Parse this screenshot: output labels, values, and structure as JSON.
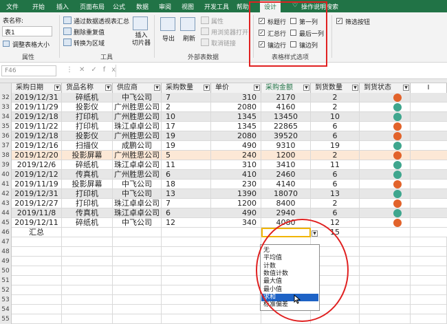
{
  "tabs": [
    "文件",
    "开始",
    "插入",
    "页面布局",
    "公式",
    "数据",
    "审阅",
    "视图",
    "开发工具",
    "帮助",
    "设计",
    "操作说明搜索"
  ],
  "active_tab": "设计",
  "ribbon": {
    "table_name_label": "表名称:",
    "table_name_value": "表1",
    "resize_table": "调整表格大小",
    "group_properties": "属性",
    "summarize_pivot": "通过数据透视表汇总",
    "remove_duplicates": "删除重复值",
    "convert_range": "转换为区域",
    "insert_slicer": "插入\n切片器",
    "group_tools": "工具",
    "export": "导出",
    "refresh": "刷新",
    "properties": "属性",
    "open_browser": "用浏览器打开",
    "unlink": "取消链接",
    "group_external": "外部表数据",
    "opt_header_row": "标题行",
    "opt_first_col": "第一列",
    "opt_filter_btn": "筛选按钮",
    "opt_total_row": "汇总行",
    "opt_last_col": "最后一列",
    "opt_banded_rows": "镶边行",
    "opt_banded_cols": "镶边列",
    "group_style_options": "表格样式选项"
  },
  "formula_bar": {
    "cell_ref": "F46",
    "fx": "fx"
  },
  "columns": [
    "采购日期",
    "货品名称",
    "供应商",
    "采购数量",
    "单价",
    "采购金额",
    "到货数量",
    "到货状态"
  ],
  "rows": [
    {
      "n": "32",
      "date": "2019/12/31",
      "item": "碎纸机",
      "supplier": "中飞公司",
      "qty": "7",
      "price": "310",
      "amount": "2170",
      "arrived": "2",
      "status": "orange"
    },
    {
      "n": "33",
      "date": "2019/11/29",
      "item": "投影仪",
      "supplier": "广州胜思公司",
      "qty": "2",
      "price": "2080",
      "amount": "4160",
      "arrived": "2",
      "status": "teal"
    },
    {
      "n": "34",
      "date": "2019/12/18",
      "item": "打印机",
      "supplier": "广州胜思公司",
      "qty": "10",
      "price": "1345",
      "amount": "13450",
      "arrived": "10",
      "status": "teal"
    },
    {
      "n": "35",
      "date": "2019/11/22",
      "item": "打印机",
      "supplier": "珠江卓卓公司",
      "qty": "17",
      "price": "1345",
      "amount": "22865",
      "arrived": "6",
      "status": "orange"
    },
    {
      "n": "36",
      "date": "2019/12/18",
      "item": "投影仪",
      "supplier": "广州胜思公司",
      "qty": "19",
      "price": "2080",
      "amount": "39520",
      "arrived": "6",
      "status": "orange"
    },
    {
      "n": "37",
      "date": "2019/12/16",
      "item": "扫描仪",
      "supplier": "成鹏公司",
      "qty": "19",
      "price": "490",
      "amount": "9310",
      "arrived": "19",
      "status": "teal"
    },
    {
      "n": "38",
      "date": "2019/12/20",
      "item": "投影屏幕",
      "supplier": "广州胜思公司",
      "qty": "5",
      "price": "240",
      "amount": "1200",
      "arrived": "2",
      "status": "orange"
    },
    {
      "n": "39",
      "date": "2019/12/6",
      "item": "碎纸机",
      "supplier": "珠江卓卓公司",
      "qty": "11",
      "price": "310",
      "amount": "3410",
      "arrived": "11",
      "status": "teal"
    },
    {
      "n": "40",
      "date": "2019/12/12",
      "item": "传真机",
      "supplier": "广州胜思公司",
      "qty": "6",
      "price": "410",
      "amount": "2460",
      "arrived": "6",
      "status": "teal"
    },
    {
      "n": "41",
      "date": "2019/11/19",
      "item": "投影屏幕",
      "supplier": "中飞公司",
      "qty": "18",
      "price": "230",
      "amount": "4140",
      "arrived": "6",
      "status": "orange"
    },
    {
      "n": "42",
      "date": "2019/12/31",
      "item": "打印机",
      "supplier": "中飞公司",
      "qty": "13",
      "price": "1390",
      "amount": "18070",
      "arrived": "13",
      "status": "teal"
    },
    {
      "n": "43",
      "date": "2019/12/27",
      "item": "打印机",
      "supplier": "珠江卓卓公司",
      "qty": "7",
      "price": "1200",
      "amount": "8400",
      "arrived": "2",
      "status": "orange"
    },
    {
      "n": "44",
      "date": "2019/11/8",
      "item": "传真机",
      "supplier": "珠江卓卓公司",
      "qty": "6",
      "price": "490",
      "amount": "2940",
      "arrived": "6",
      "status": "teal"
    },
    {
      "n": "45",
      "date": "2019/12/11",
      "item": "碎纸机",
      "supplier": "中飞公司",
      "qty": "12",
      "price": "340",
      "amount": "4080",
      "arrived": "12",
      "status": "orange"
    }
  ],
  "total_row": {
    "n": "46",
    "label": "汇总",
    "arrived_total": "15"
  },
  "empty_rows": [
    "47",
    "48",
    "49",
    "50",
    "51",
    "52",
    "53",
    "54",
    "55"
  ],
  "dropdown_options": [
    "无",
    "平均值",
    "计数",
    "数值计数",
    "最大值",
    "最小值",
    "求和",
    "标准偏差"
  ],
  "dropdown_selected": "求和",
  "colors": {
    "accent": "#217346",
    "status_orange": "#e2632b",
    "status_teal": "#3fa68e",
    "band": "#e7e7e7",
    "selected_row": "#fce8d6",
    "annotation": "#e02020"
  }
}
